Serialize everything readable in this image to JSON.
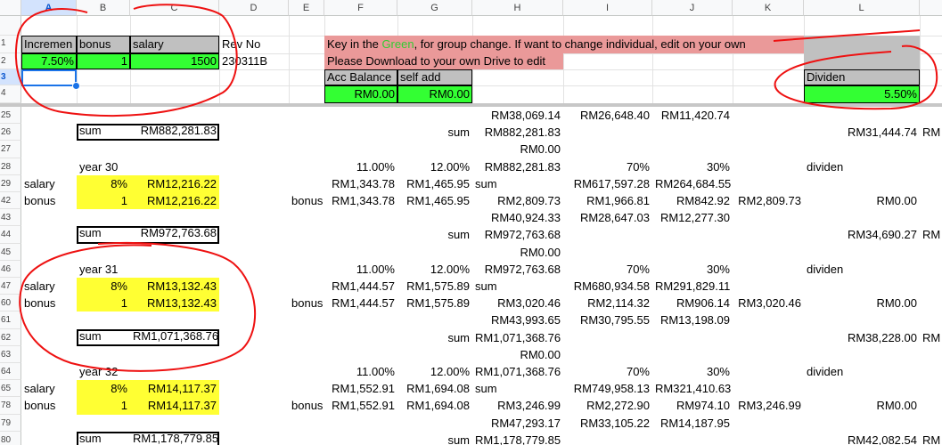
{
  "columns": [
    "A",
    "B",
    "C",
    "D",
    "E",
    "F",
    "G",
    "H",
    "I",
    "J",
    "K",
    "L"
  ],
  "top_rows": [
    "1",
    "2",
    "3",
    "4"
  ],
  "body_rows": [
    "25",
    "26",
    "27",
    "28",
    "29",
    "42",
    "43",
    "44",
    "45",
    "46",
    "47",
    "60",
    "61",
    "62",
    "63",
    "64",
    "65",
    "78",
    "79",
    "80"
  ],
  "header": {
    "a1": "Incremen",
    "b1": "bonus",
    "c1": "salary",
    "d1": "Rev No",
    "a2": "7.50%",
    "b2": "1",
    "c2": "1500",
    "d2": "230311B",
    "note1_before": "Key in the ",
    "note1_green": "Green",
    "note1_after": ", for group change. If want to change individual, edit on your own",
    "note2": "Please Download to your own Drive to edit",
    "f3": "Acc Balance",
    "g3": "self add",
    "f4": "RM0.00",
    "g4": "RM0.00",
    "l3": "Dividen",
    "l4": "5.50%"
  },
  "r25": {
    "h": "RM38,069.14",
    "i": "RM26,648.40",
    "j": "RM11,420.74"
  },
  "r26": {
    "b": "sum",
    "c": "RM882,281.83",
    "g": "sum",
    "h": "RM882,281.83",
    "l": "RM31,444.74",
    "m": "RM"
  },
  "r27": {
    "h": "RM0.00"
  },
  "r28": {
    "b": "year 30",
    "f": "11.00%",
    "g": "12.00%",
    "h": "RM882,281.83",
    "i": "70%",
    "j": "30%",
    "l": "dividen"
  },
  "r29": {
    "a": "salary",
    "b": "8%",
    "c": "RM12,216.22",
    "f": "RM1,343.78",
    "g": "RM1,465.95",
    "h": "sum",
    "i": "RM617,597.28",
    "j": "RM264,684.55"
  },
  "r42": {
    "a": "bonus",
    "b": "1",
    "c": "RM12,216.22",
    "e": "bonus",
    "f": "RM1,343.78",
    "g": "RM1,465.95",
    "h": "RM2,809.73",
    "i": "RM1,966.81",
    "j": "RM842.92",
    "k": "RM2,809.73",
    "l": "RM0.00"
  },
  "r43": {
    "h": "RM40,924.33",
    "i": "RM28,647.03",
    "j": "RM12,277.30"
  },
  "r44": {
    "b": "sum",
    "c": "RM972,763.68",
    "g": "sum",
    "h": "RM972,763.68",
    "l": "RM34,690.27",
    "m": "RM"
  },
  "r45": {
    "h": "RM0.00"
  },
  "r46": {
    "b": "year 31",
    "f": "11.00%",
    "g": "12.00%",
    "h": "RM972,763.68",
    "i": "70%",
    "j": "30%",
    "l": "dividen"
  },
  "r47": {
    "a": "salary",
    "b": "8%",
    "c": "RM13,132.43",
    "f": "RM1,444.57",
    "g": "RM1,575.89",
    "h": "sum",
    "i": "RM680,934.58",
    "j": "RM291,829.11"
  },
  "r60": {
    "a": "bonus",
    "b": "1",
    "c": "RM13,132.43",
    "e": "bonus",
    "f": "RM1,444.57",
    "g": "RM1,575.89",
    "h": "RM3,020.46",
    "i": "RM2,114.32",
    "j": "RM906.14",
    "k": "RM3,020.46",
    "l": "RM0.00"
  },
  "r61": {
    "h": "RM43,993.65",
    "i": "RM30,795.55",
    "j": "RM13,198.09"
  },
  "r62": {
    "b": "sum",
    "c": "RM1,071,368.76",
    "g": "sum",
    "h": "RM1,071,368.76",
    "l": "RM38,228.00",
    "m": "RM"
  },
  "r63": {
    "h": "RM0.00"
  },
  "r64": {
    "b": "year 32",
    "f": "11.00%",
    "g": "12.00%",
    "h": "RM1,071,368.76",
    "i": "70%",
    "j": "30%",
    "l": "dividen"
  },
  "r65": {
    "a": "salary",
    "b": "8%",
    "c": "RM14,117.37",
    "f": "RM1,552.91",
    "g": "RM1,694.08",
    "h": "sum",
    "i": "RM749,958.13",
    "j": "RM321,410.63"
  },
  "r78": {
    "a": "bonus",
    "b": "1",
    "c": "RM14,117.37",
    "e": "bonus",
    "f": "RM1,552.91",
    "g": "RM1,694.08",
    "h": "RM3,246.99",
    "i": "RM2,272.90",
    "j": "RM974.10",
    "k": "RM3,246.99",
    "l": "RM0.00"
  },
  "r79": {
    "h": "RM47,293.17",
    "i": "RM33,105.22",
    "j": "RM14,187.95"
  },
  "r80": {
    "b": "sum",
    "c": "RM1,178,779.85",
    "g": "sum",
    "h": "RM1,178,779.85",
    "l": "RM42,082.54",
    "m": "RM"
  },
  "colors": {
    "green": "#33ff33",
    "yellow": "#ffff33",
    "pink": "#ea9999",
    "gray": "#c0c0c0",
    "ink": "#ee1111",
    "selection": "#1a73e8"
  }
}
